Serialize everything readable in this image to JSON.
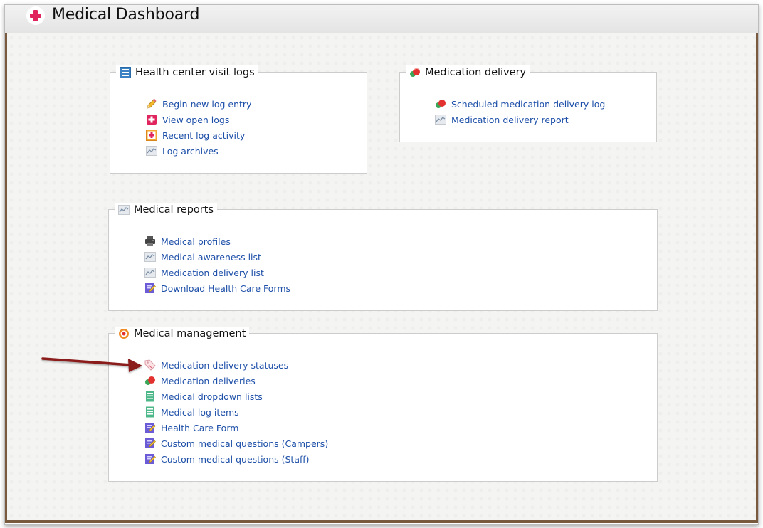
{
  "header": {
    "title": "Medical Dashboard",
    "icon": "medical-cross-icon",
    "accent": "#e0245e"
  },
  "panels": {
    "health_logs": {
      "title": "Health center visit logs",
      "icon": "list-icon",
      "links": [
        {
          "label": "Begin new log entry",
          "icon": "pencil-icon"
        },
        {
          "label": "View open logs",
          "icon": "medical-cross-icon"
        },
        {
          "label": "Recent log activity",
          "icon": "first-aid-icon"
        },
        {
          "label": "Log archives",
          "icon": "chart-icon"
        }
      ]
    },
    "medication_delivery": {
      "title": "Medication delivery",
      "icon": "pills-icon",
      "links": [
        {
          "label": "Scheduled medication delivery log",
          "icon": "pills-icon"
        },
        {
          "label": "Medication delivery report",
          "icon": "chart-icon"
        }
      ]
    },
    "medical_reports": {
      "title": "Medical reports",
      "icon": "chart-icon",
      "links": [
        {
          "label": "Medical profiles",
          "icon": "printer-icon"
        },
        {
          "label": "Medical awareness list",
          "icon": "chart-icon"
        },
        {
          "label": "Medication delivery list",
          "icon": "chart-icon"
        },
        {
          "label": "Download Health Care Forms",
          "icon": "form-edit-icon"
        }
      ]
    },
    "medical_management": {
      "title": "Medical management",
      "icon": "gear-icon",
      "links": [
        {
          "label": "Medication delivery statuses",
          "icon": "tag-icon"
        },
        {
          "label": "Medication deliveries",
          "icon": "pills-icon"
        },
        {
          "label": "Medical dropdown lists",
          "icon": "list-icon"
        },
        {
          "label": "Medical log items",
          "icon": "list-icon"
        },
        {
          "label": "Health Care Form",
          "icon": "form-edit-icon"
        },
        {
          "label": "Custom medical questions (Campers)",
          "icon": "form-edit-icon"
        },
        {
          "label": "Custom medical questions (Staff)",
          "icon": "form-edit-icon"
        }
      ]
    }
  },
  "annotation": {
    "icon": "arrow-icon",
    "color": "#8b1a1a"
  },
  "colors": {
    "link": "#1d4fa8",
    "frame_border": "#7a5a3e"
  }
}
